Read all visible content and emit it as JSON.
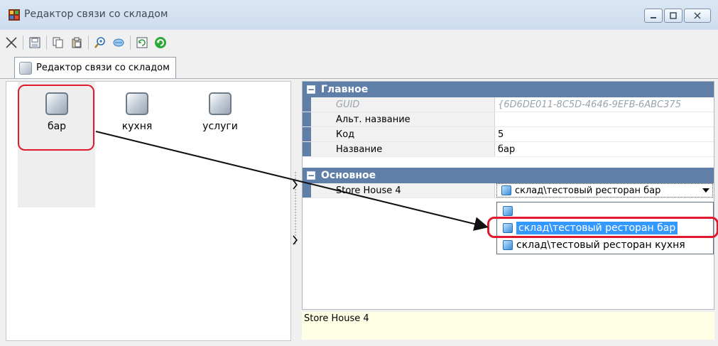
{
  "window": {
    "title": "Редактор связи со складом"
  },
  "toolbar": {
    "buttons": [
      "close-x-icon",
      "save-icon",
      "copy-icon",
      "paste-icon",
      "zoom-icon",
      "filter-icon",
      "refresh-page-icon",
      "refresh-green-icon"
    ]
  },
  "tab": {
    "label": "Редактор связи со складом"
  },
  "items": [
    {
      "label": "бар"
    },
    {
      "label": "кухня"
    },
    {
      "label": "услуги"
    }
  ],
  "properties": {
    "main_group": "Главное",
    "rows": [
      {
        "name": "GUID",
        "value": "{6D6DE011-8C5D-4646-9EFB-6ABC375"
      },
      {
        "name": "Альт. название",
        "value": ""
      },
      {
        "name": "Код",
        "value": "5"
      },
      {
        "name": "Название",
        "value": "бар"
      }
    ],
    "basic_group": "Основное",
    "store_row": {
      "name": "Store House 4",
      "value": "склад\\тестовый ресторан бар"
    }
  },
  "dropdown": {
    "options": [
      "",
      "склад\\тестовый ресторан бар",
      "склад\\тестовый ресторан кухня"
    ],
    "selected_index": 1
  },
  "description": "Store House 4",
  "colors": {
    "category": "#5f7fa8",
    "highlight": "#3399ff",
    "annotation": "#e0192c"
  }
}
